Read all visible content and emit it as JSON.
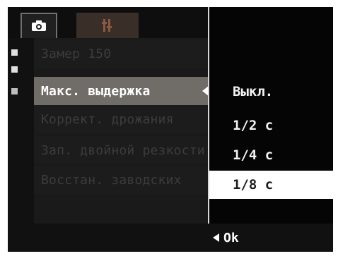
{
  "tabs": [
    {
      "name": "camera-tab",
      "icon": "camera-icon"
    },
    {
      "name": "setup-tab",
      "icon": "setup-icon"
    }
  ],
  "menu": {
    "items": [
      {
        "label": "Замер 150",
        "state": "dim"
      },
      {
        "label": "Макс. выдержка",
        "state": "active"
      },
      {
        "label": "Коррект. дрожания",
        "state": "dim"
      },
      {
        "label": "Зап. двойной резкости",
        "state": "dim"
      },
      {
        "label": "Восстан. заводских",
        "state": "dim"
      }
    ]
  },
  "popup": {
    "options": [
      "Выкл.",
      "1/2 с",
      "1/4 с",
      "1/8 с"
    ],
    "selected_index": 3
  },
  "footer": {
    "ok_label": "Ok"
  },
  "colors": {
    "active_row": "#706c68",
    "selected_option": "#ffffff",
    "background": "#1a1a1a"
  }
}
